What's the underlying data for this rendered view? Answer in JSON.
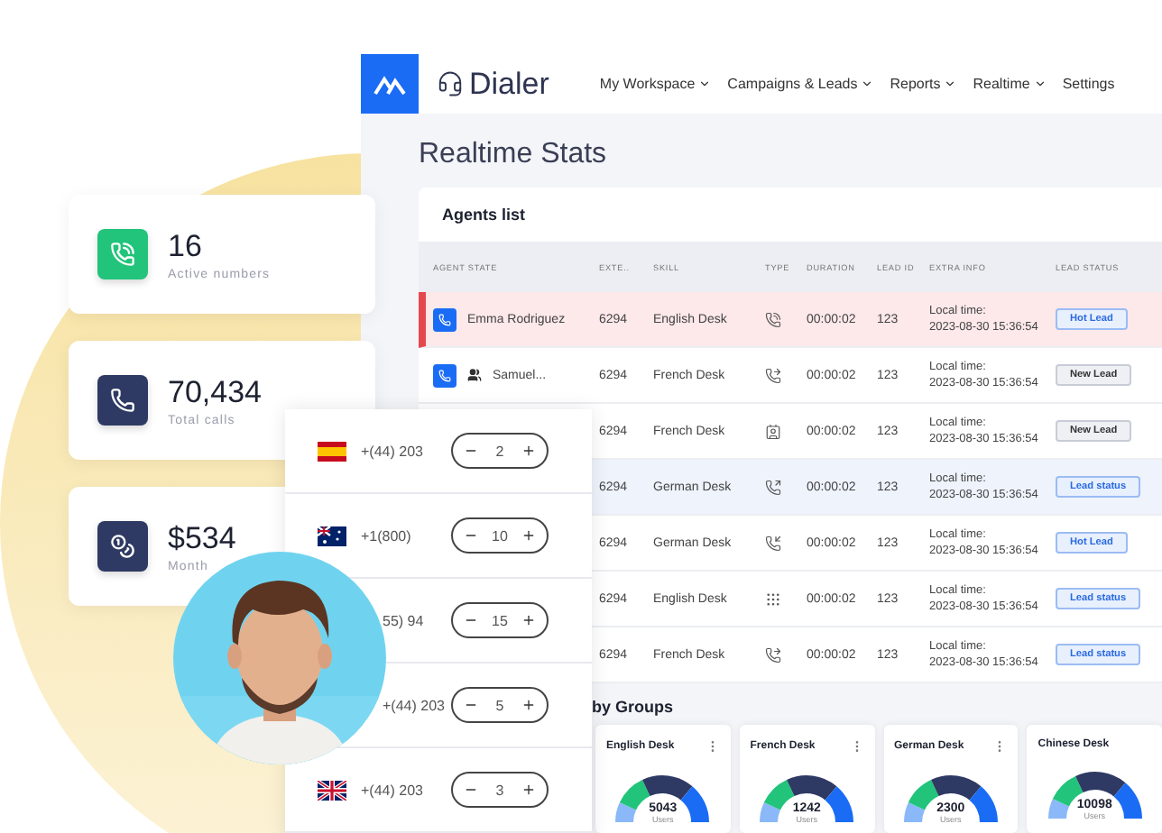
{
  "app": {
    "brand": "Dialer",
    "nav": [
      {
        "label": "My Workspace",
        "dropdown": true
      },
      {
        "label": "Campaigns & Leads",
        "dropdown": true
      },
      {
        "label": "Reports",
        "dropdown": true
      },
      {
        "label": "Realtime",
        "dropdown": true
      },
      {
        "label": "Settings",
        "dropdown": false
      }
    ]
  },
  "page_title": "Realtime Stats",
  "agents": {
    "title": "Agents list",
    "columns": [
      "AGENT STATE",
      "EXTE..",
      "SKILL",
      "TYPE",
      "DURATION",
      "LEAD ID",
      "EXTRA INFO",
      "LEAD STATUS"
    ],
    "rows": [
      {
        "alert": true,
        "selected": false,
        "agent": "Emma Rodriguez",
        "team": false,
        "ext": "6294",
        "skill": "English Desk",
        "type": {
          "kind": "ringing"
        },
        "duration": "00:00:02",
        "lead_id": "123",
        "extra_label": "Local time:",
        "extra_time": "2023-08-30 15:36:54",
        "lead_status": {
          "label": "Hot Lead",
          "kind": "hot"
        }
      },
      {
        "alert": false,
        "selected": false,
        "agent": "Samuel...",
        "team": true,
        "ext": "6294",
        "skill": "French Desk",
        "type": {
          "kind": "forward"
        },
        "duration": "00:00:02",
        "lead_id": "123",
        "extra_label": "Local time:",
        "extra_time": "2023-08-30 15:36:54",
        "lead_status": {
          "label": "New Lead",
          "kind": "new"
        }
      },
      {
        "alert": false,
        "selected": false,
        "ext": "6294",
        "skill": "French Desk",
        "type": {
          "kind": "card"
        },
        "duration": "00:00:02",
        "lead_id": "123",
        "extra_label": "Local time:",
        "extra_time": "2023-08-30 15:36:54",
        "lead_status": {
          "label": "New Lead",
          "kind": "new"
        }
      },
      {
        "alert": false,
        "selected": true,
        "ext": "6294",
        "skill": "German Desk",
        "type": {
          "kind": "outgoing"
        },
        "duration": "00:00:02",
        "lead_id": "123",
        "extra_label": "Local time:",
        "extra_time": "2023-08-30 15:36:54",
        "lead_status": {
          "label": "Lead status",
          "kind": "status"
        }
      },
      {
        "alert": false,
        "selected": false,
        "ext": "6294",
        "skill": "German Desk",
        "type": {
          "kind": "incoming"
        },
        "duration": "00:00:02",
        "lead_id": "123",
        "extra_label": "Local time:",
        "extra_time": "2023-08-30 15:36:54",
        "lead_status": {
          "label": "Hot Lead",
          "kind": "hot"
        }
      },
      {
        "alert": false,
        "selected": false,
        "ext": "6294",
        "skill": "English Desk",
        "type": {
          "kind": "keypad"
        },
        "duration": "00:00:02",
        "lead_id": "123",
        "extra_label": "Local time:",
        "extra_time": "2023-08-30 15:36:54",
        "lead_status": {
          "label": "Lead status",
          "kind": "status"
        }
      },
      {
        "alert": false,
        "selected": false,
        "ext": "6294",
        "skill": "French Desk",
        "type": {
          "kind": "forward"
        },
        "duration": "00:00:02",
        "lead_id": "123",
        "extra_label": "Local time:",
        "extra_time": "2023-08-30 15:36:54",
        "lead_status": {
          "label": "Lead status",
          "kind": "status"
        }
      }
    ]
  },
  "groups": {
    "title": "by Groups",
    "cards": [
      {
        "name": "English Desk",
        "value": "5043",
        "unit": "Users",
        "menu": true
      },
      {
        "name": "French Desk",
        "value": "1242",
        "unit": "Users",
        "menu": true
      },
      {
        "name": "German Desk",
        "value": "2300",
        "unit": "Users",
        "menu": true
      },
      {
        "name": "Chinese Desk",
        "value": "10098",
        "unit": "Users",
        "menu": false
      }
    ]
  },
  "stats": [
    {
      "kind": "signal",
      "value": "16",
      "label": "Active numbers"
    },
    {
      "kind": "phone",
      "value": "70,434",
      "label": "Total calls"
    },
    {
      "kind": "coins",
      "value": "$534",
      "label": "Month"
    }
  ],
  "numbers": [
    {
      "flag": {
        "kind": "es"
      },
      "number": "+(44) 203",
      "count": "2"
    },
    {
      "flag": {
        "kind": "au"
      },
      "number": "+1(800)",
      "count": "10"
    },
    {
      "number": "55) 94",
      "count": "15"
    },
    {
      "number": "+(44) 203",
      "count": "5"
    },
    {
      "flag": {
        "kind": "gb"
      },
      "number": "+(44) 203",
      "count": "3"
    }
  ]
}
